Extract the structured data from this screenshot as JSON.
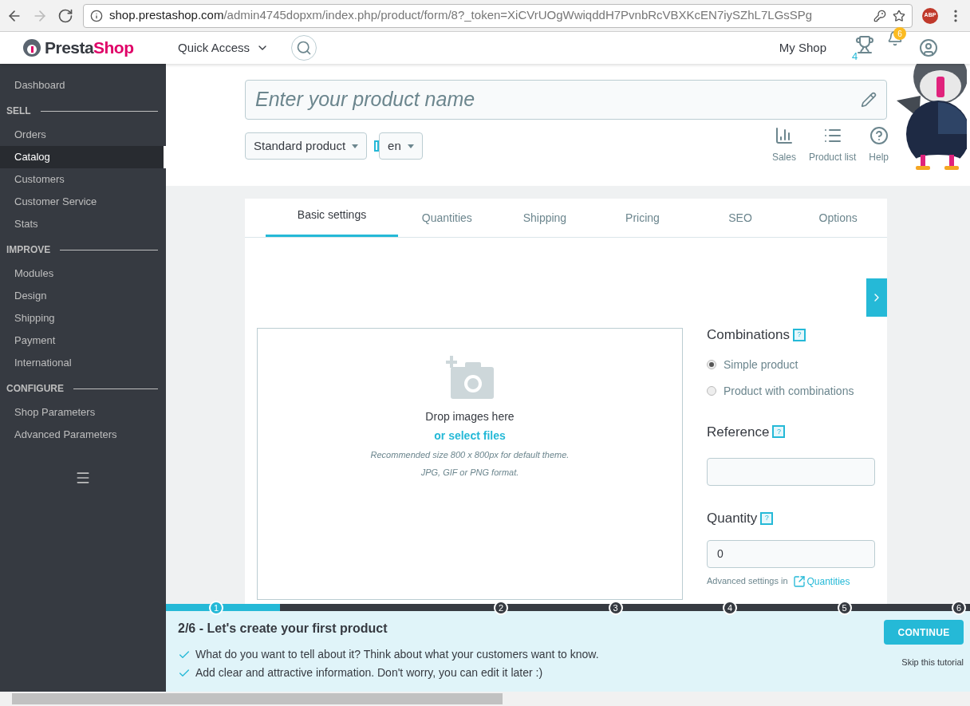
{
  "browser": {
    "url_host": "shop.prestashop.com",
    "url_path": "/admin4745dopxm/index.php/product/form/8?_token=XiCVrUOgWwiqddH7PvnbRcVBXKcEN7iySZhL7LGsSPg",
    "extension_badge": "ABP"
  },
  "header": {
    "logo": {
      "part_1": "Presta",
      "part_2": "Shop"
    },
    "quick_access": "Quick Access",
    "shop_name": "My Shop",
    "trophy_count": "4",
    "notification_count": "6"
  },
  "sidebar": {
    "items": [
      {
        "kind": "item",
        "label": "Dashboard",
        "selected": false
      },
      {
        "kind": "section",
        "label": "SELL"
      },
      {
        "kind": "item",
        "label": "Orders",
        "selected": false
      },
      {
        "kind": "item",
        "label": "Catalog",
        "selected": true
      },
      {
        "kind": "item",
        "label": "Customers",
        "selected": false
      },
      {
        "kind": "item",
        "label": "Customer Service",
        "selected": false
      },
      {
        "kind": "item",
        "label": "Stats",
        "selected": false
      },
      {
        "kind": "section",
        "label": "IMPROVE"
      },
      {
        "kind": "item",
        "label": "Modules",
        "selected": false
      },
      {
        "kind": "item",
        "label": "Design",
        "selected": false
      },
      {
        "kind": "item",
        "label": "Shipping",
        "selected": false
      },
      {
        "kind": "item",
        "label": "Payment",
        "selected": false
      },
      {
        "kind": "item",
        "label": "International",
        "selected": false
      },
      {
        "kind": "section",
        "label": "CONFIGURE"
      },
      {
        "kind": "item",
        "label": "Shop Parameters",
        "selected": false
      },
      {
        "kind": "item",
        "label": "Advanced Parameters",
        "selected": false
      }
    ]
  },
  "product": {
    "name_placeholder": "Enter your product name",
    "type": "Standard product",
    "language": "en",
    "toolbar": [
      {
        "kind": "sales",
        "label": "Sales"
      },
      {
        "kind": "list",
        "label": "Product list"
      },
      {
        "kind": "help",
        "label": "Help"
      }
    ]
  },
  "tabs": [
    {
      "label": "Basic settings",
      "selected": true
    },
    {
      "label": "Quantities",
      "selected": false
    },
    {
      "label": "Shipping",
      "selected": false
    },
    {
      "label": "Pricing",
      "selected": false
    },
    {
      "label": "SEO",
      "selected": false
    },
    {
      "label": "Options",
      "selected": false
    }
  ],
  "upload": {
    "title": "Drop images here",
    "link": "or select files",
    "hint_1": "Recommended size 800 x 800px for default theme.",
    "hint_2": "JPG, GIF or PNG format."
  },
  "side_form": {
    "combinations_label": "Combinations",
    "help_mark": "?",
    "options": [
      {
        "label": "Simple product",
        "selected": true
      },
      {
        "label": "Product with combinations",
        "selected": false
      }
    ],
    "reference_label": "Reference",
    "quantity_label": "Quantity",
    "quantity_value": "0",
    "advanced_text": "Advanced settings in",
    "advanced_link": "Quantities"
  },
  "tutorial": {
    "level": 0.142,
    "steps": [
      {
        "label": "1",
        "current": true
      },
      {
        "label": "2",
        "current": false
      },
      {
        "label": "3",
        "current": false
      },
      {
        "label": "4",
        "current": false
      },
      {
        "label": "5",
        "current": false
      },
      {
        "label": "6",
        "current": false
      }
    ],
    "title": "2/6 - Let's create your first product",
    "bullets": [
      "What do you want to tell about it? Think about what your customers want to know.",
      "Add clear and attractive information. Don't worry, you can edit it later :)"
    ],
    "continue": "CONTINUE",
    "skip": "Skip this tutorial"
  }
}
